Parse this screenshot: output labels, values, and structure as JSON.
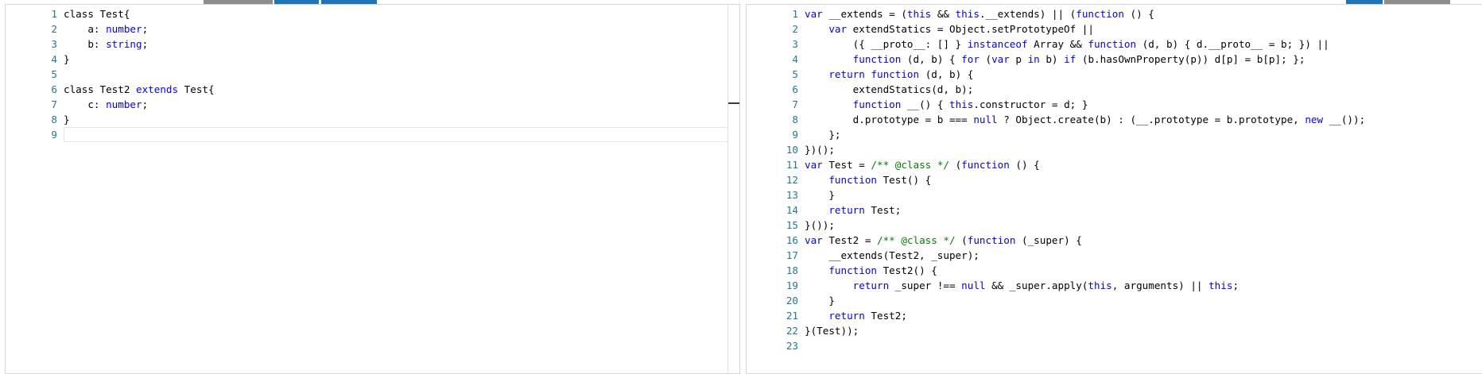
{
  "colors": {
    "keyword": "#0000ff",
    "comment": "#008000",
    "line_number": "#237893",
    "text": "#000000",
    "tab_grey": "#8c8c8c",
    "tab_blue": "#1f73b7"
  },
  "left_editor": {
    "lines": [
      {
        "n": "1",
        "tokens": [
          {
            "t": "class Test{",
            "c": ""
          }
        ]
      },
      {
        "n": "2",
        "tokens": [
          {
            "t": "    a: ",
            "c": ""
          },
          {
            "t": "number",
            "c": "ty"
          },
          {
            "t": ";",
            "c": ""
          }
        ]
      },
      {
        "n": "3",
        "tokens": [
          {
            "t": "    b: ",
            "c": ""
          },
          {
            "t": "string",
            "c": "ty"
          },
          {
            "t": ";",
            "c": ""
          }
        ]
      },
      {
        "n": "4",
        "tokens": [
          {
            "t": "}",
            "c": ""
          }
        ]
      },
      {
        "n": "5",
        "tokens": []
      },
      {
        "n": "6",
        "tokens": [
          {
            "t": "class Test2 ",
            "c": ""
          },
          {
            "t": "extends",
            "c": "kw"
          },
          {
            "t": " Test{",
            "c": ""
          }
        ]
      },
      {
        "n": "7",
        "tokens": [
          {
            "t": "    c: ",
            "c": ""
          },
          {
            "t": "number",
            "c": "ty"
          },
          {
            "t": ";",
            "c": ""
          }
        ]
      },
      {
        "n": "8",
        "tokens": [
          {
            "t": "}",
            "c": ""
          }
        ]
      },
      {
        "n": "9",
        "tokens": [],
        "current": true
      }
    ]
  },
  "right_editor": {
    "lines": [
      {
        "n": "1",
        "tokens": [
          {
            "t": "var",
            "c": "kw"
          },
          {
            "t": " __extends = (",
            "c": ""
          },
          {
            "t": "this",
            "c": "kw"
          },
          {
            "t": " && ",
            "c": ""
          },
          {
            "t": "this",
            "c": "kw"
          },
          {
            "t": ".__extends) || (",
            "c": ""
          },
          {
            "t": "function",
            "c": "kw"
          },
          {
            "t": " () {",
            "c": ""
          }
        ]
      },
      {
        "n": "2",
        "tokens": [
          {
            "t": "    ",
            "c": ""
          },
          {
            "t": "var",
            "c": "kw"
          },
          {
            "t": " extendStatics = Object.setPrototypeOf ||",
            "c": ""
          }
        ]
      },
      {
        "n": "3",
        "tokens": [
          {
            "t": "        ({ __proto__: [] } ",
            "c": ""
          },
          {
            "t": "instanceof",
            "c": "kw"
          },
          {
            "t": " Array && ",
            "c": ""
          },
          {
            "t": "function",
            "c": "kw"
          },
          {
            "t": " (d, b) { d.__proto__ = b; }) ||",
            "c": ""
          }
        ]
      },
      {
        "n": "4",
        "tokens": [
          {
            "t": "        ",
            "c": ""
          },
          {
            "t": "function",
            "c": "kw"
          },
          {
            "t": " (d, b) { ",
            "c": ""
          },
          {
            "t": "for",
            "c": "kw"
          },
          {
            "t": " (",
            "c": ""
          },
          {
            "t": "var",
            "c": "kw"
          },
          {
            "t": " p ",
            "c": ""
          },
          {
            "t": "in",
            "c": "kw"
          },
          {
            "t": " b) ",
            "c": ""
          },
          {
            "t": "if",
            "c": "kw"
          },
          {
            "t": " (b.hasOwnProperty(p)) d[p] = b[p]; };",
            "c": ""
          }
        ]
      },
      {
        "n": "5",
        "tokens": [
          {
            "t": "    ",
            "c": ""
          },
          {
            "t": "return",
            "c": "kw"
          },
          {
            "t": " ",
            "c": ""
          },
          {
            "t": "function",
            "c": "kw"
          },
          {
            "t": " (d, b) {",
            "c": ""
          }
        ]
      },
      {
        "n": "6",
        "tokens": [
          {
            "t": "        extendStatics(d, b);",
            "c": ""
          }
        ]
      },
      {
        "n": "7",
        "tokens": [
          {
            "t": "        ",
            "c": ""
          },
          {
            "t": "function",
            "c": "kw"
          },
          {
            "t": " __() { ",
            "c": ""
          },
          {
            "t": "this",
            "c": "kw"
          },
          {
            "t": ".constructor = d; }",
            "c": ""
          }
        ]
      },
      {
        "n": "8",
        "tokens": [
          {
            "t": "        d.prototype = b === ",
            "c": ""
          },
          {
            "t": "null",
            "c": "kw"
          },
          {
            "t": " ? Object.create(b) : (__.prototype = b.prototype, ",
            "c": ""
          },
          {
            "t": "new",
            "c": "kw"
          },
          {
            "t": " __());",
            "c": ""
          }
        ]
      },
      {
        "n": "9",
        "tokens": [
          {
            "t": "    };",
            "c": ""
          }
        ]
      },
      {
        "n": "10",
        "tokens": [
          {
            "t": "})();",
            "c": ""
          }
        ]
      },
      {
        "n": "11",
        "tokens": [
          {
            "t": "var",
            "c": "kw"
          },
          {
            "t": " Test = ",
            "c": ""
          },
          {
            "t": "/** @class */",
            "c": "cm"
          },
          {
            "t": " (",
            "c": ""
          },
          {
            "t": "function",
            "c": "kw"
          },
          {
            "t": " () {",
            "c": ""
          }
        ]
      },
      {
        "n": "12",
        "tokens": [
          {
            "t": "    ",
            "c": ""
          },
          {
            "t": "function",
            "c": "kw"
          },
          {
            "t": " Test() {",
            "c": ""
          }
        ]
      },
      {
        "n": "13",
        "tokens": [
          {
            "t": "    }",
            "c": ""
          }
        ]
      },
      {
        "n": "14",
        "tokens": [
          {
            "t": "    ",
            "c": ""
          },
          {
            "t": "return",
            "c": "kw"
          },
          {
            "t": " Test;",
            "c": ""
          }
        ]
      },
      {
        "n": "15",
        "tokens": [
          {
            "t": "}());",
            "c": ""
          }
        ]
      },
      {
        "n": "16",
        "tokens": [
          {
            "t": "var",
            "c": "kw"
          },
          {
            "t": " Test2 = ",
            "c": ""
          },
          {
            "t": "/** @class */",
            "c": "cm"
          },
          {
            "t": " (",
            "c": ""
          },
          {
            "t": "function",
            "c": "kw"
          },
          {
            "t": " (_super) {",
            "c": ""
          }
        ]
      },
      {
        "n": "17",
        "tokens": [
          {
            "t": "    __extends(Test2, _super);",
            "c": ""
          }
        ]
      },
      {
        "n": "18",
        "tokens": [
          {
            "t": "    ",
            "c": ""
          },
          {
            "t": "function",
            "c": "kw"
          },
          {
            "t": " Test2() {",
            "c": ""
          }
        ]
      },
      {
        "n": "19",
        "tokens": [
          {
            "t": "        ",
            "c": ""
          },
          {
            "t": "return",
            "c": "kw"
          },
          {
            "t": " _super !== ",
            "c": ""
          },
          {
            "t": "null",
            "c": "kw"
          },
          {
            "t": " && _super.apply(",
            "c": ""
          },
          {
            "t": "this",
            "c": "kw"
          },
          {
            "t": ", arguments) || ",
            "c": ""
          },
          {
            "t": "this",
            "c": "kw"
          },
          {
            "t": ";",
            "c": ""
          }
        ]
      },
      {
        "n": "20",
        "tokens": [
          {
            "t": "    }",
            "c": ""
          }
        ]
      },
      {
        "n": "21",
        "tokens": [
          {
            "t": "    ",
            "c": ""
          },
          {
            "t": "return",
            "c": "kw"
          },
          {
            "t": " Test2;",
            "c": ""
          }
        ]
      },
      {
        "n": "22",
        "tokens": [
          {
            "t": "}(Test));",
            "c": ""
          }
        ]
      },
      {
        "n": "23",
        "tokens": []
      }
    ]
  }
}
